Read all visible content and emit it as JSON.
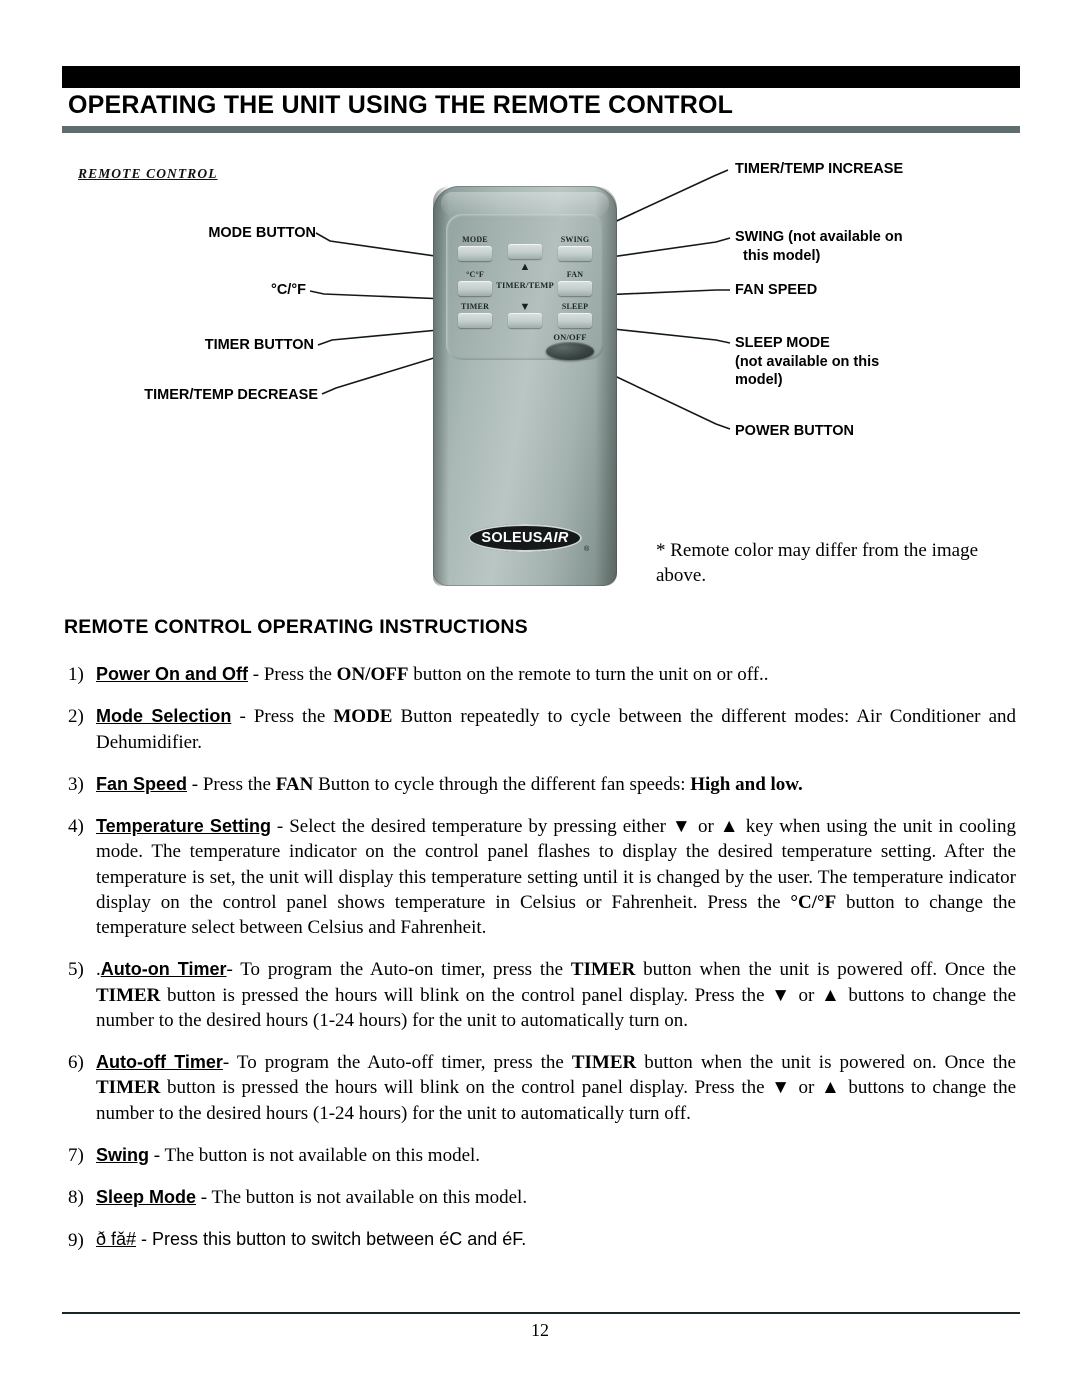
{
  "document": {
    "title": "OPERATING THE UNIT USING THE REMOTE CONTROL",
    "page_number": "12"
  },
  "figure": {
    "caption": "REMOTE CONTROL",
    "note": "* Remote color may differ from the image above.",
    "brand": {
      "name_bold": "SOLEUS",
      "name_italic": "AIR",
      "registered": "®"
    },
    "callouts_left": [
      {
        "id": "mode-button",
        "label": "MODE BUTTON"
      },
      {
        "id": "celsius-fahrenheit",
        "label": "°C/°F"
      },
      {
        "id": "timer-button",
        "label": "TIMER BUTTON"
      },
      {
        "id": "timer-temp-decrease",
        "label": "TIMER/TEMP DECREASE"
      }
    ],
    "callouts_right": [
      {
        "id": "timer-temp-increase",
        "label": "TIMER/TEMP INCREASE",
        "sub": ""
      },
      {
        "id": "swing",
        "label": "SWING (not available on",
        "sub": "this model)"
      },
      {
        "id": "fan-speed",
        "label": "FAN SPEED",
        "sub": ""
      },
      {
        "id": "sleep-mode",
        "label": "SLEEP MODE",
        "sub": "(not available on this",
        "sub2": "model)"
      },
      {
        "id": "power-button",
        "label": "POWER BUTTON",
        "sub": ""
      }
    ],
    "remote_buttons": {
      "mode": "MODE",
      "swing": "SWING",
      "deg_cf": "°C°F",
      "fan": "FAN",
      "timer": "TIMER",
      "sleep": "SLEEP",
      "timer_temp": "TIMER/TEMP",
      "up_arrow": "▲",
      "down_arrow": "▼",
      "on_off": "ON/OFF"
    }
  },
  "instructions": {
    "heading": "REMOTE CONTROL OPERATING INSTRUCTIONS",
    "items": [
      {
        "num": "1)",
        "term": "Power On and Off",
        "dash": " - ",
        "text_a": "Press the ",
        "bold_a": "ON/OFF",
        "text_b": "  button on the remote to turn the unit on or off.."
      },
      {
        "num": "2)",
        "term": "Mode Selection",
        "dash": " - ",
        "text_a": "Press the ",
        "bold_a": "MODE",
        "text_b": " Button repeatedly to cycle between the different modes: Air Conditioner and Dehumidifier."
      },
      {
        "num": "3)",
        "term": "Fan Speed",
        "dash": " - ",
        "text_a": "Press the ",
        "bold_a": "FAN",
        "text_b": " Button to cycle through the different fan speeds: ",
        "bold_b": "High and low."
      },
      {
        "num": "4)",
        "term": "Temperature Setting",
        "dash": " - ",
        "text_a": "Select the desired temperature by pressing either ▼ or ▲ key when using the unit in cooling mode. The temperature indicator on the control panel flashes to display the desired temperature setting. After the temperature is set, the unit will display this temperature setting until it is changed by the user. The temperature indicator display on the control panel shows temperature in Celsius or Fahrenheit.  Press the  ",
        "bold_a": "°C/°F",
        "text_b": "  button to change the temperature select between  Celsius and Fahrenheit."
      },
      {
        "num": "5)",
        "prefix": ".",
        "term": "Auto-on Timer",
        "dash": "- ",
        "text_a": "To program the Auto-on timer,  press the ",
        "bold_a": "TIMER",
        "text_b": " button when the unit is powered off. Once the ",
        "bold_b": "TIMER",
        "text_c": " button is pressed the hours will blink on the control panel display. Press the ▼ or ▲ buttons to change the number to the desired hours (1-24 hours) for the unit to automatically turn on."
      },
      {
        "num": "6)",
        "term": "Auto-off Timer",
        "dash": "- ",
        "text_a": "To program the Auto-off timer,  press the ",
        "bold_a": "TIMER",
        "text_b": " button when the unit is powered on. Once the ",
        "bold_b": "TIMER",
        "text_c": " button is pressed the hours will blink on the control panel display. Press the ▼ or ▲ buttons to change the number to the desired hours (1-24 hours) for the unit to automatically turn off."
      },
      {
        "num": "7)",
        "term": "Swing",
        "dash": " - ",
        "text_a": "The button is not available on this model."
      },
      {
        "num": "8)",
        "term": "Sleep Mode",
        "dash": " - ",
        "text_a": "The button is not available on this model."
      },
      {
        "num": "9)",
        "term": "ð fǎ#",
        "dash": " - ",
        "text_a": "Press this button to switch between éC and éF."
      }
    ]
  },
  "colors": {
    "header_bar": "#000000",
    "header_rule": "#5d6d70",
    "footer_rule": "#1b2426",
    "remote_body": "#a4b2af",
    "remote_button": "#c3cecb",
    "onoff_button": "#2b3534"
  }
}
